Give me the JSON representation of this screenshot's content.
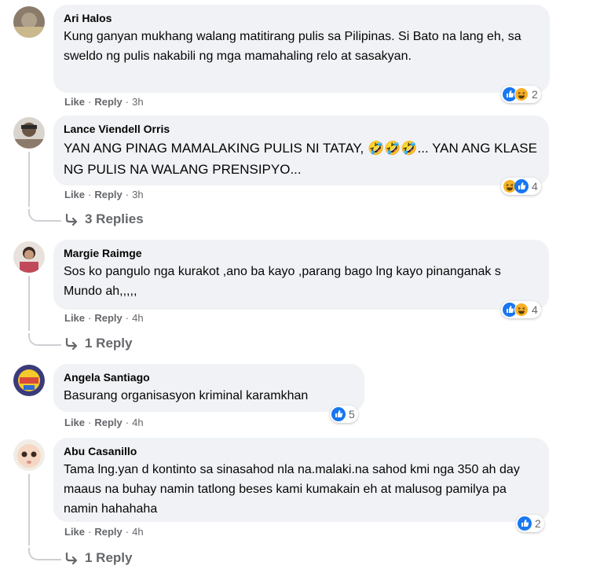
{
  "comments": [
    {
      "author": "Ari Halos",
      "text": "Kung ganyan mukhang walang matitirang pulis sa Pilipinas. Si Bato na lang eh, sa sweldo ng pulis nakabili ng mga mamahaling relo at sasakyan.",
      "like": "Like",
      "reply": "Reply",
      "time": "3h",
      "reaction_count": "2"
    },
    {
      "author": "Lance Viendell Orris",
      "text": "YAN ANG PINAG MAMALAKING PULIS NI TATAY, 🤣🤣🤣... YAN ANG KLASE NG PULIS NA WALANG PRENSIPYO...",
      "like": "Like",
      "reply": "Reply",
      "time": "3h",
      "reaction_count": "4",
      "replies_label": "3 Replies"
    },
    {
      "author": "Margie Raimge",
      "text": "Sos ko pangulo nga kurakot ,ano ba kayo ,parang bago lng kayo pinanganak s Mundo ah,,,,,",
      "like": "Like",
      "reply": "Reply",
      "time": "4h",
      "reaction_count": "4",
      "replies_label": "1 Reply"
    },
    {
      "author": "Angela Santiago",
      "text": "Basurang organisasyon kriminal karamkhan",
      "like": "Like",
      "reply": "Reply",
      "time": "4h",
      "reaction_count": "5"
    },
    {
      "author": "Abu Casanillo",
      "text": "Tama lng.yan d kontinto sa sinasahod nla na.malaki.na sahod kmi nga 350 ah day maaus na buhay namin tatlong beses kami kumakain eh at malusog pamilya pa namin hahahaha",
      "like": "Like",
      "reply": "Reply",
      "time": "4h",
      "reaction_count": "2",
      "replies_label": "1 Reply"
    }
  ],
  "colors": {
    "bubble": "#f0f2f5",
    "meta_text": "#65676b",
    "like_blue": "#1877f2",
    "haha_yellow": "#f7b125"
  }
}
